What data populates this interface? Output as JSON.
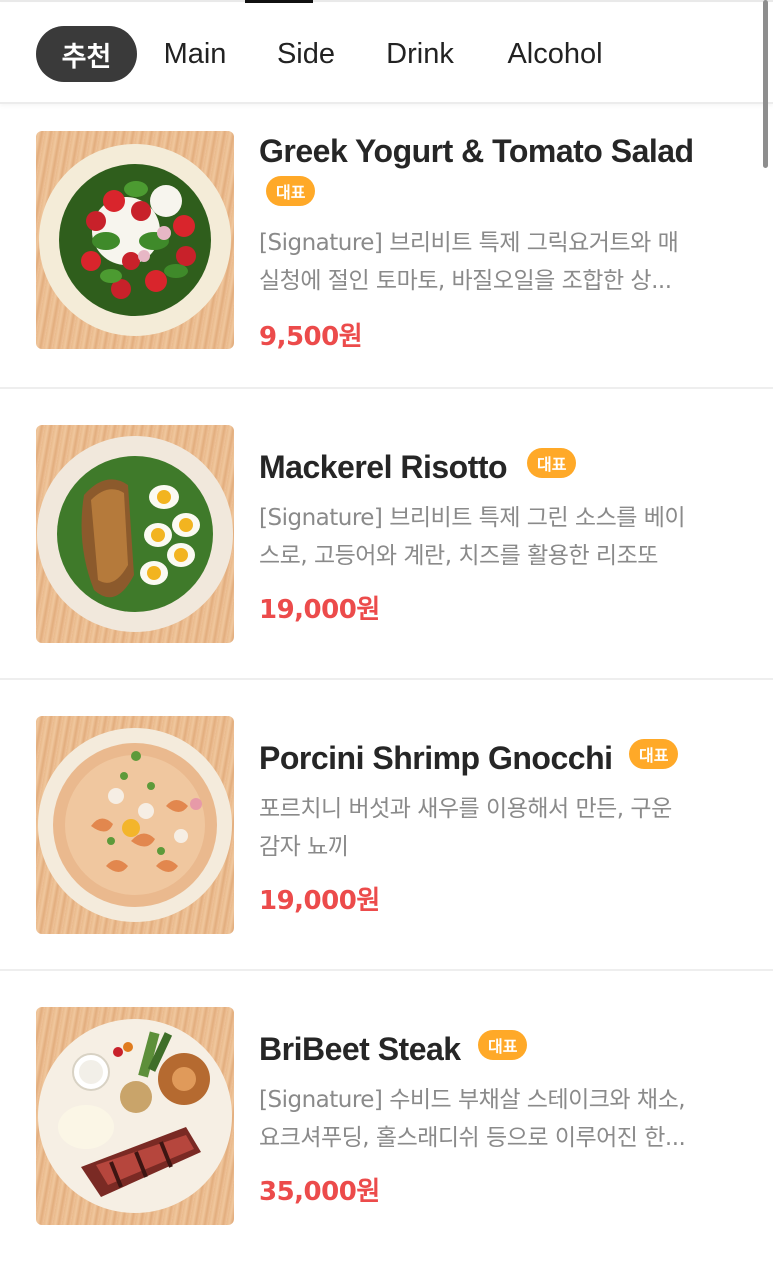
{
  "tabs": [
    {
      "label": "추천",
      "active": true
    },
    {
      "label": "Main",
      "active": false
    },
    {
      "label": "Side",
      "active": false
    },
    {
      "label": "Drink",
      "active": false
    },
    {
      "label": "Alcohol",
      "active": false
    }
  ],
  "colors": {
    "accent_price": "#ec4b4b",
    "badge": "#ffa928",
    "active_tab": "#3a3a3a"
  },
  "menu": [
    {
      "name": "Greek Yogurt & Tomato Salad",
      "badge": "대표",
      "description_lines": [
        "[Signature] 브리비트 특제 그릭요거트와 매",
        "실청에 절인 토마토, 바질오일을 조합한 상..."
      ],
      "price": "9,500원",
      "image": "salad-photo"
    },
    {
      "name": "Mackerel Risotto",
      "badge": "대표",
      "description_lines": [
        "[Signature] 브리비트 특제 그린 소스를 베이",
        "스로, 고등어와 계란, 치즈를 활용한 리조또"
      ],
      "price": "19,000원",
      "image": "risotto-photo"
    },
    {
      "name": "Porcini Shrimp Gnocchi",
      "badge": "대표",
      "description_lines": [
        "포르치니 버섯과 새우를 이용해서 만든, 구운",
        "감자 뇨끼"
      ],
      "price": "19,000원",
      "image": "gnocchi-photo"
    },
    {
      "name": "BriBeet Steak",
      "badge": "대표",
      "description_lines": [
        "[Signature] 수비드 부채살 스테이크와 채소,",
        "요크셔푸딩, 홀스래디쉬 등으로 이루어진 한..."
      ],
      "price": "35,000원",
      "image": "steak-photo"
    }
  ]
}
